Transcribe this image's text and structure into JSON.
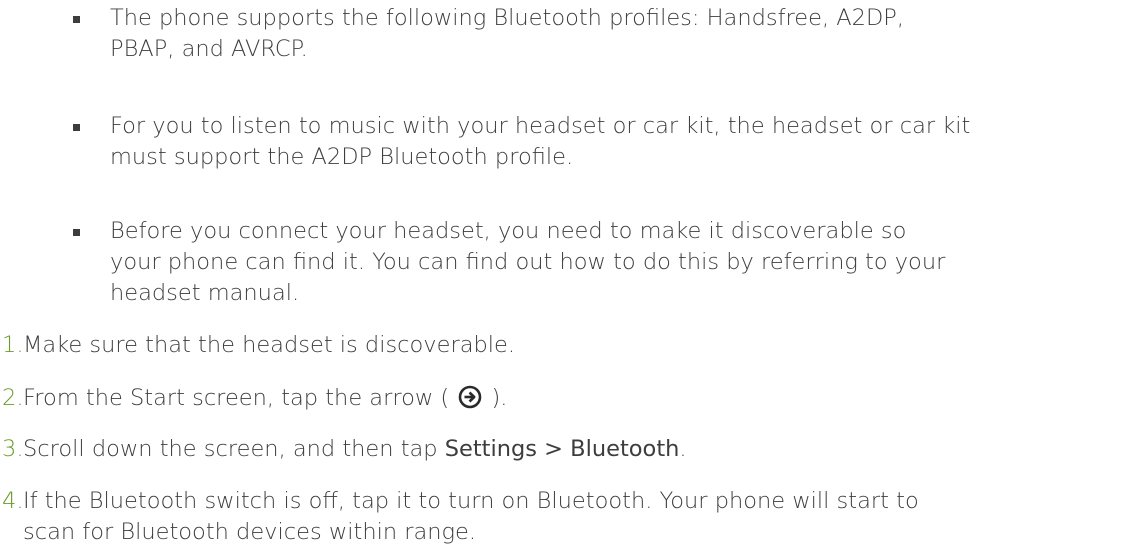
{
  "notes": [
    {
      "text": "The phone supports the following Bluetooth profiles: Handsfree, A2DP,\nPBAP, and AVRCP."
    },
    {
      "text": "For you to listen to music with your headset or car kit, the headset or car kit\nmust support the A2DP Bluetooth profile."
    },
    {
      "text": "Before you connect your headset, you need to make it discoverable so\nyour phone can find it. You can find out how to do this by referring to your\nheadset manual."
    }
  ],
  "steps": [
    {
      "num": "1.",
      "text": "Make sure that the headset is discoverable."
    },
    {
      "num": "2.",
      "text_before": "From the Start screen, tap the arrow (",
      "icon": "right-arrow-circle-icon",
      "text_after": ")."
    },
    {
      "num": "3.",
      "text_before": "Scroll down the screen, and then tap ",
      "strong": "Settings > Bluetooth",
      "text_after": "."
    },
    {
      "num": "4.",
      "text": "If the Bluetooth switch is off, tap it to turn on Bluetooth. Your phone will start to\nscan for Bluetooth devices within range."
    }
  ],
  "colors": {
    "text": "#3d3d3d",
    "step_number": "#6a9a2a"
  }
}
